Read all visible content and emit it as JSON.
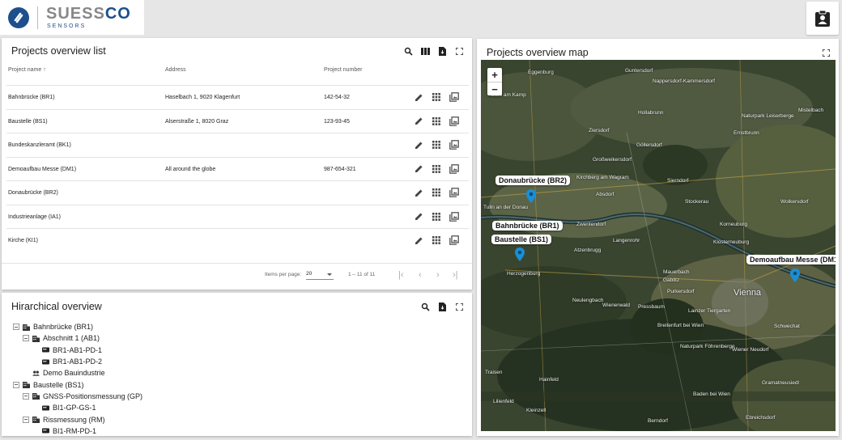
{
  "brand": {
    "name_main": "SUESS",
    "name_accent": "CO",
    "name_sub": "SENSORS"
  },
  "list_panel": {
    "title": "Projects overview list",
    "columns": {
      "name": "Project name",
      "address": "Address",
      "number": "Project number"
    },
    "rows": [
      {
        "name": "Bahnbrücke (BR1)",
        "address": "Haselbach 1, 9020 Klagenfurt",
        "number": "142-54-32"
      },
      {
        "name": "Baustelle (BS1)",
        "address": "Alserstraße 1, 8020 Graz",
        "number": "123-93-45"
      },
      {
        "name": "Bundeskanzleramt (BK1)",
        "address": "",
        "number": ""
      },
      {
        "name": "Demoaufbau Messe (DM1)",
        "address": "All around the globe",
        "number": "987-654-321"
      },
      {
        "name": "Donaubrücke (BR2)",
        "address": "",
        "number": ""
      },
      {
        "name": "Industrieanlage (IA1)",
        "address": "",
        "number": ""
      },
      {
        "name": "Kirche (KI1)",
        "address": "",
        "number": ""
      }
    ],
    "paginator": {
      "items_label": "Items per page:",
      "page_size": "20",
      "range": "1 – 11 of 11"
    }
  },
  "tree_panel": {
    "title": "Hirarchical overview",
    "nodes": [
      {
        "label": "Bahnbrücke (BR1)",
        "level": 0,
        "toggle": true,
        "icon": "building-icon"
      },
      {
        "label": "Abschnitt 1 (AB1)",
        "level": 1,
        "toggle": true,
        "icon": "building-icon"
      },
      {
        "label": "BR1-AB1-PD-1",
        "level": 2,
        "toggle": false,
        "icon": "sensor-icon"
      },
      {
        "label": "BR1-AB1-PD-2",
        "level": 2,
        "toggle": false,
        "icon": "sensor-icon"
      },
      {
        "label": "Demo Bauindustrie",
        "level": 1,
        "toggle": false,
        "icon": "group-icon"
      },
      {
        "label": "Baustelle (BS1)",
        "level": 0,
        "toggle": true,
        "icon": "building-icon"
      },
      {
        "label": "GNSS-Positionsmessung (GP)",
        "level": 1,
        "toggle": true,
        "icon": "building-icon"
      },
      {
        "label": "BI1-GP-GS-1",
        "level": 2,
        "toggle": false,
        "icon": "sensor-icon"
      },
      {
        "label": "Rissmessung (RM)",
        "level": 1,
        "toggle": true,
        "icon": "building-icon"
      },
      {
        "label": "BI1-RM-PD-1",
        "level": 2,
        "toggle": false,
        "icon": "sensor-icon"
      }
    ]
  },
  "map_panel": {
    "title": "Projects overview map",
    "zoom_in": "+",
    "zoom_out": "−",
    "markers": [
      {
        "label": "Donaubrücke (BR2)"
      },
      {
        "label": "Bahnbrücke (BR1)"
      },
      {
        "label": "Baustelle (BS1)"
      },
      {
        "label": "Demoaufbau Messe (DM1)"
      }
    ],
    "places": [
      "Eggenburg",
      "Gars am Kamp",
      "Guntersdorf",
      "Nappersdorf-Kammersdorf",
      "Hollabrunn",
      "Ziersdorf",
      "Großweikersdorf",
      "Göllersdorf",
      "Naturpark Leiserberge",
      "Ernstbrunn",
      "Mistelbach",
      "Kirchberg am Wagram",
      "Absdorf",
      "Sierndorf",
      "Stockerau",
      "Korneuburg",
      "Wolkersdorf",
      "Tulln an der Donau",
      "Zwentendorf",
      "Langenrohr",
      "Klosterneuburg",
      "Atzenbrugg",
      "Herzogenburg",
      "Mauerbach",
      "Gablitz",
      "Purkersdorf",
      "Vienna",
      "Neulengbach",
      "Wienerwald",
      "Pressbaum",
      "Lainzer Tiergarten",
      "Breitenfurt bei Wien",
      "Schwechat",
      "Naturpark Föhrenberge",
      "Wiener Neudorf",
      "Hainfeld",
      "Traisen",
      "Baden bei Wien",
      "Berndorf",
      "Ebreichsdorf",
      "Gramatneusiedl",
      "Kleinzell",
      "Lilienfeld"
    ],
    "accent_color": "#1a8fd6"
  }
}
